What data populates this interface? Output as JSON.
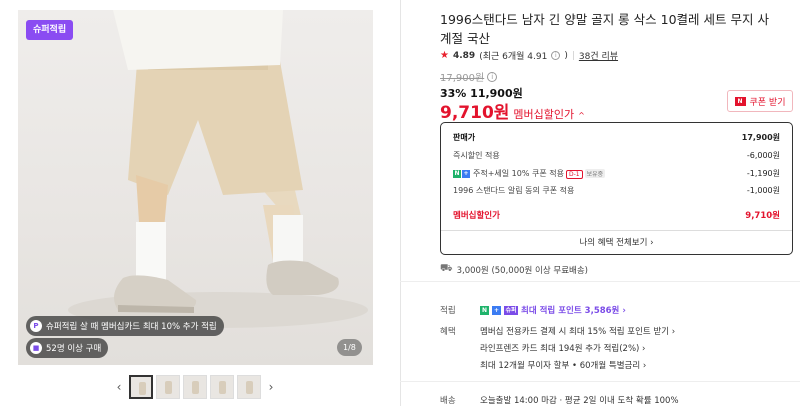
{
  "gallery": {
    "badge": "슈퍼적립",
    "chip_card": "슈퍼적립 살 때 멤버십카드 최대 10% 추가 적립",
    "chip_buyers": "52명 이상 구매",
    "page_counter": "1/8",
    "prev_arrow": "‹",
    "next_arrow": "›",
    "thumbnail_count": 5
  },
  "product": {
    "title": "1996스탠다드 남자 긴 양말 골지 롱 삭스 10켤레 세트 무지 사계절 국산",
    "rating": {
      "star": "★",
      "score": "4.89",
      "recent": "(최근 6개월 4.91",
      "recent_end": ")",
      "info_icon": "i",
      "reviews": "38건 리뷰"
    },
    "original_price": "17,900원",
    "sale_price": "33% 11,900원",
    "member_price": "9,710원",
    "member_label": "멤버십할인가",
    "member_caret": "^",
    "coupon_button": "쿠폰 받기"
  },
  "price_breakdown": {
    "rows": [
      {
        "label": "판매가",
        "value": "17,900원"
      },
      {
        "label": "즉시할인 적용",
        "value": "-6,000원"
      },
      {
        "label": "주적+세일 10% 쿠폰 적용",
        "tag_d": "D-1",
        "tag_g": "보유중",
        "value": "-1,190원"
      },
      {
        "label": "1996 스탠다드 알림 동의 쿠폰 적용",
        "value": "-1,000원"
      }
    ],
    "total_label": "멤버십할인가",
    "total_value": "9,710원",
    "benefits_link": "나의 혜택 전체보기 ›"
  },
  "shipping": {
    "text": "3,000원 (50,000원 이상 무료배송)"
  },
  "info": {
    "points_key": "적립",
    "points_tags": [
      "N",
      "+",
      "슈퍼"
    ],
    "points_text": "최대 적립 포인트",
    "points_value": "3,586원 ›",
    "benefit_key": "혜택",
    "benefit_lines": [
      "멤버십 전용카드 결제 시 최대 15% 적립 포인트 받기 ›",
      "라인프렌즈 카드 최대 194원 추가 적립(2%) ›",
      "최대 12개월 무이자 할부 • 60개월 특별금리 ›"
    ],
    "delivery_key": "배송",
    "delivery_text": "오늘출발 14:00 마감 · 평균 2일 이내 도착 확률 100%"
  },
  "colors": {
    "accent_red": "#e3132d",
    "super_purple": "#8a4cf2",
    "naver_green": "#1fb36b"
  }
}
